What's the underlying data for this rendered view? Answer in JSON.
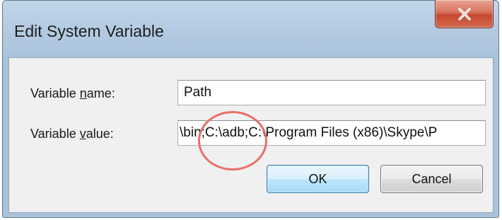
{
  "window": {
    "title": "Edit System Variable",
    "close_icon": "close-x-icon"
  },
  "form": {
    "name_label_pre": "Variable ",
    "name_label_accel": "n",
    "name_label_post": "ame:",
    "name_value": "Path",
    "value_label_pre": "Variable ",
    "value_label_accel": "v",
    "value_label_post": "alue:",
    "value_value": "\\bin;C:\\adb;C:\\Program Files (x86)\\Skype\\P"
  },
  "buttons": {
    "ok_label": "OK",
    "cancel_label": "Cancel"
  },
  "annotation": {
    "shape": "circle",
    "color": "#e8706a",
    "highlights": "C:\\adb"
  },
  "colors": {
    "titlebar": "#b9cfe5",
    "close_button": "#c9503a",
    "client_background": "#f0f0f0",
    "ok_button_border": "#3c7fb1"
  }
}
